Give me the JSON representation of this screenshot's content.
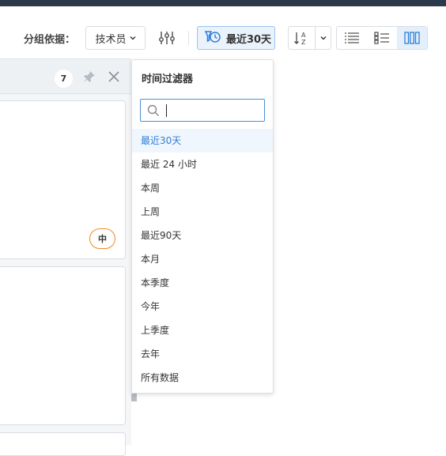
{
  "toolbar": {
    "group_by_label": "分组依据：",
    "group_by_value": "技术员",
    "time_filter_label": "最近30天"
  },
  "panel": {
    "count": "7",
    "priority_badge": "中"
  },
  "dropdown": {
    "title": "时间过滤器",
    "search_value": "",
    "items": [
      {
        "label": "最近30天",
        "selected": true
      },
      {
        "label": "最近 24 小时",
        "selected": false
      },
      {
        "label": "本周",
        "selected": false
      },
      {
        "label": "上周",
        "selected": false
      },
      {
        "label": "最近90天",
        "selected": false
      },
      {
        "label": "本月",
        "selected": false
      },
      {
        "label": "本季度",
        "selected": false
      },
      {
        "label": "今年",
        "selected": false
      },
      {
        "label": "上季度",
        "selected": false
      },
      {
        "label": "去年",
        "selected": false
      },
      {
        "label": "所有数据",
        "selected": false
      }
    ]
  },
  "colors": {
    "accent": "#2f7fd6",
    "priority_medium": "#f08a24",
    "topbar": "#2b3a4a"
  },
  "icons": [
    "chevron-down-icon",
    "sliders-icon",
    "clock-filter-icon",
    "sort-az-icon",
    "list-view-icon",
    "checklist-view-icon",
    "board-view-icon",
    "pin-icon",
    "close-icon",
    "search-icon"
  ]
}
